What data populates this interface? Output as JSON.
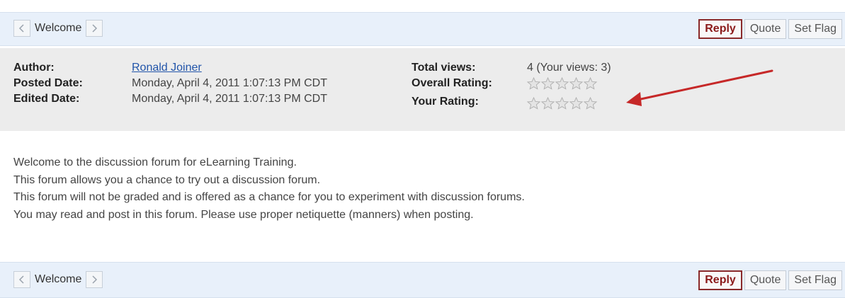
{
  "nav": {
    "label": "Welcome"
  },
  "actions": {
    "reply": "Reply",
    "quote": "Quote",
    "set_flag": "Set Flag",
    "set_flag_bottom": "Set Flag"
  },
  "meta": {
    "author_label": "Author:",
    "author_name": "Ronald Joiner",
    "posted_label": "Posted Date:",
    "posted_value": "Monday, April 4, 2011 1:07:13 PM CDT",
    "edited_label": "Edited Date:",
    "edited_value": "Monday, April 4, 2011 1:07:13 PM CDT",
    "views_label": "Total views:",
    "views_value": "4 (Your views: 3)",
    "overall_rating_label": "Overall Rating:",
    "overall_rating_value": 0,
    "your_rating_label": "Your Rating:",
    "your_rating_value": 0,
    "rating_max": 5
  },
  "message": {
    "lines": [
      "Welcome to the discussion forum for eLearning Training.",
      "This forum allows you a chance to try out a discussion forum.",
      "This forum will not be graded and is offered as a chance for you to experiment with discussion forums.",
      "You may read and post in this forum. Please use proper netiquette (manners) when posting."
    ]
  },
  "colors": {
    "annotation_arrow": "#c62828",
    "reply_border": "#8a2a2a",
    "link": "#2255aa"
  }
}
